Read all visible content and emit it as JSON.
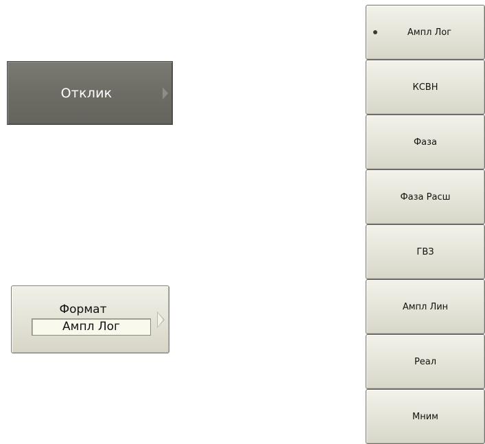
{
  "left_panel": {
    "response_button": {
      "label": "Отклик",
      "arrow_icon": "chevron-right-icon"
    },
    "format_button": {
      "label": "Формат",
      "value": "Ампл Лог",
      "arrow_icon": "chevron-right-icon"
    }
  },
  "format_menu": {
    "selected_bullet_icon": "radio-dot-icon",
    "items": [
      {
        "label": "Ампл Лог",
        "selected": true
      },
      {
        "label": "КСВН",
        "selected": false
      },
      {
        "label": "Фаза",
        "selected": false
      },
      {
        "label": "Фаза Расш",
        "selected": false
      },
      {
        "label": "ГВЗ",
        "selected": false
      },
      {
        "label": "Ампл Лин",
        "selected": false
      },
      {
        "label": "Реал",
        "selected": false
      },
      {
        "label": "Мним",
        "selected": false
      }
    ]
  }
}
